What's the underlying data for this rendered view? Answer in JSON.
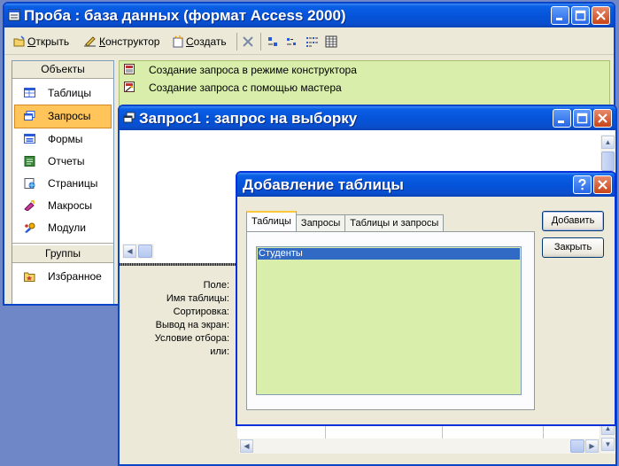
{
  "db_window": {
    "title": "Проба : база данных (формат Access 2000)",
    "toolbar": {
      "open_prefix": "",
      "open_u": "О",
      "open_rest": "ткрыть",
      "design_u": "К",
      "design_rest": "онструктор",
      "create_u": "С",
      "create_rest": "оздать"
    },
    "sidebar": {
      "objects_header": "Объекты",
      "items": [
        {
          "label": "Таблицы",
          "icon": "table-icon"
        },
        {
          "label": "Запросы",
          "icon": "query-icon"
        },
        {
          "label": "Формы",
          "icon": "form-icon"
        },
        {
          "label": "Отчеты",
          "icon": "report-icon"
        },
        {
          "label": "Страницы",
          "icon": "page-icon"
        },
        {
          "label": "Макросы",
          "icon": "macro-icon"
        },
        {
          "label": "Модули",
          "icon": "module-icon"
        }
      ],
      "selected": "Запросы",
      "groups_header": "Группы",
      "favorites": "Избранное"
    },
    "object_list": [
      "Создание запроса в режиме конструктора",
      "Создание запроса с помощью мастера"
    ]
  },
  "query_window": {
    "title": "Запрос1 : запрос на выборку",
    "grid_rows": [
      "Поле:",
      "Имя таблицы:",
      "Сортировка:",
      "Вывод на экран:",
      "Условие отбора:",
      "или:"
    ]
  },
  "dialog": {
    "title": "Добавление таблицы",
    "tabs": [
      "Таблицы",
      "Запросы",
      "Таблицы и запросы"
    ],
    "active_tab": "Таблицы",
    "list_items": [
      "Студенты"
    ],
    "add_button": "Добавить",
    "close_button": "Закрыть"
  },
  "colors": {
    "title_blue": "#0553d8",
    "list_green": "#d9eeaa",
    "selection_orange": "#ffc55a",
    "selection_blue": "#316ac5"
  }
}
